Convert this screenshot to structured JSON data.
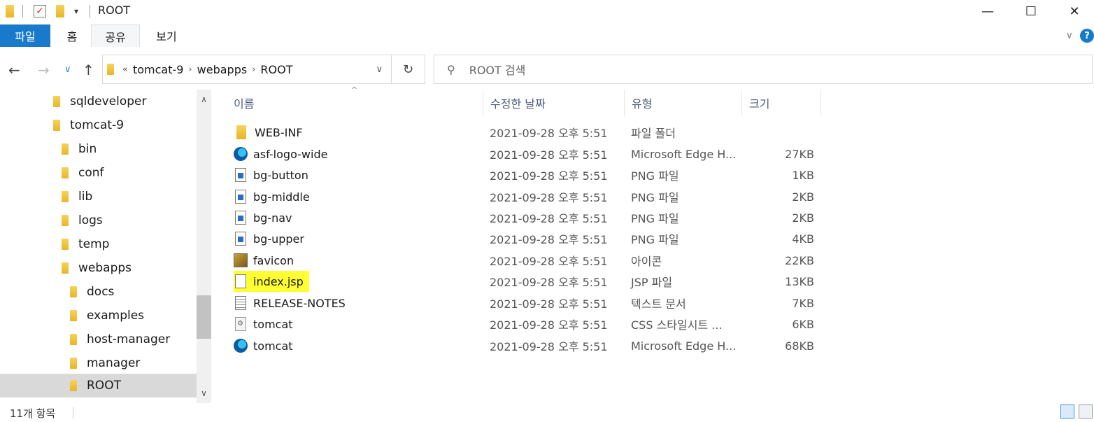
{
  "window": {
    "title": "ROOT",
    "minimize_glyph": "—",
    "maximize_glyph": "☐",
    "close_glyph": "✕"
  },
  "quick_access": {
    "dropdown_glyph": "▾"
  },
  "ribbon": {
    "tabs": [
      {
        "label": "파일"
      },
      {
        "label": "홈"
      },
      {
        "label": "공유"
      },
      {
        "label": "보기"
      }
    ],
    "expand_glyph": "∨",
    "help_glyph": "?"
  },
  "address_bar": {
    "back_glyph": "←",
    "forward_glyph": "→",
    "recent_glyph": "∨",
    "up_glyph": "↑",
    "overflow": "«",
    "crumbs": [
      "tomcat-9",
      "webapps",
      "ROOT"
    ],
    "crumb_sep": "›",
    "dropdown_glyph": "∨",
    "refresh_glyph": "↻"
  },
  "search": {
    "placeholder": "ROOT 검색"
  },
  "nav_tree": {
    "items": [
      {
        "label": "sqldeveloper"
      },
      {
        "label": "tomcat-9"
      },
      {
        "label": "bin"
      },
      {
        "label": "conf"
      },
      {
        "label": "lib"
      },
      {
        "label": "logs"
      },
      {
        "label": "temp"
      },
      {
        "label": "webapps"
      },
      {
        "label": "docs"
      },
      {
        "label": "examples"
      },
      {
        "label": "host-manager"
      },
      {
        "label": "manager"
      },
      {
        "label": "ROOT"
      }
    ],
    "scroll_up_glyph": "∧",
    "scroll_down_glyph": "∨"
  },
  "file_list": {
    "columns": {
      "name": "이름",
      "date": "수정한 날짜",
      "type": "유형",
      "size": "크기"
    },
    "sort_glyph": "^",
    "rows": [
      {
        "name": "WEB-INF",
        "date": "2021-09-28 오후 5:51",
        "type": "파일 폴더",
        "size": "",
        "icon": "folder-icon"
      },
      {
        "name": "asf-logo-wide",
        "date": "2021-09-28 오후 5:51",
        "type": "Microsoft Edge H...",
        "size": "27KB",
        "icon": "edge-icon"
      },
      {
        "name": "bg-button",
        "date": "2021-09-28 오후 5:51",
        "type": "PNG 파일",
        "size": "1KB",
        "icon": "png-file-icon"
      },
      {
        "name": "bg-middle",
        "date": "2021-09-28 오후 5:51",
        "type": "PNG 파일",
        "size": "2KB",
        "icon": "png-file-icon"
      },
      {
        "name": "bg-nav",
        "date": "2021-09-28 오후 5:51",
        "type": "PNG 파일",
        "size": "2KB",
        "icon": "png-file-icon"
      },
      {
        "name": "bg-upper",
        "date": "2021-09-28 오후 5:51",
        "type": "PNG 파일",
        "size": "4KB",
        "icon": "png-file-icon"
      },
      {
        "name": "favicon",
        "date": "2021-09-28 오후 5:51",
        "type": "아이콘",
        "size": "22KB",
        "icon": "tomcat-ico-icon"
      },
      {
        "name": "index.jsp",
        "date": "2021-09-28 오후 5:51",
        "type": "JSP 파일",
        "size": "13KB",
        "icon": "jsp-file-icon",
        "highlight_color": "#ffff33"
      },
      {
        "name": "RELEASE-NOTES",
        "date": "2021-09-28 오후 5:51",
        "type": "텍스트 문서",
        "size": "7KB",
        "icon": "text-file-icon"
      },
      {
        "name": "tomcat",
        "date": "2021-09-28 오후 5:51",
        "type": "CSS 스타일시트 ...",
        "size": "6KB",
        "icon": "css-file-icon"
      },
      {
        "name": "tomcat",
        "date": "2021-09-28 오후 5:51",
        "type": "Microsoft Edge H...",
        "size": "68KB",
        "icon": "edge-icon"
      }
    ]
  },
  "status_bar": {
    "item_count": "11개 항목"
  },
  "colors": {
    "accent": "#1979ca",
    "highlight": "#ffff33",
    "folder": "#e8b527",
    "selected_tree_bg": "#d9d9d9"
  }
}
